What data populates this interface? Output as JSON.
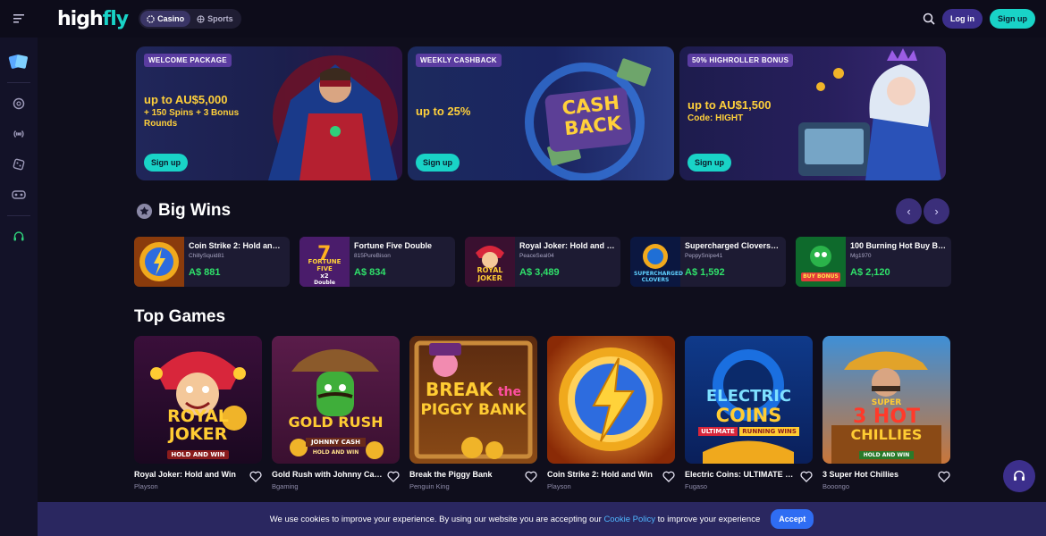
{
  "brand": {
    "logo_high": "high",
    "logo_fly": "fly"
  },
  "header": {
    "tabs": [
      {
        "label": "Casino",
        "icon": "casino-chip-icon",
        "active": true
      },
      {
        "label": "Sports",
        "icon": "sports-icon",
        "active": false
      }
    ],
    "login_label": "Log in",
    "signup_label": "Sign up"
  },
  "sidebar": {
    "items": [
      "promo-cards-icon",
      "chip-icon",
      "live-icon",
      "dice-icon",
      "vr-mask-icon",
      "support-headset-icon"
    ]
  },
  "promos": [
    {
      "tag": "WELCOME PACKAGE",
      "headline": "up to AU$5,000",
      "sub": "+ 150 Spins + 3 Bonus Rounds",
      "button": "Sign up"
    },
    {
      "tag": "WEEKLY CASHBACK",
      "headline": "up to 25%",
      "sub": "",
      "button": "Sign up",
      "art_text_1": "CASH",
      "art_text_2": "BACK"
    },
    {
      "tag": "50% HIGHROLLER BONUS",
      "headline": "up to AU$1,500",
      "sub": "Code: HIGHT",
      "button": "Sign up"
    }
  ],
  "big_wins": {
    "title": "Big Wins",
    "items": [
      {
        "game": "Coin Strike 2: Hold and Win",
        "user": "ChillySquid81",
        "amount": "A$ 881"
      },
      {
        "game": "Fortune Five Double",
        "user": "815PureBison",
        "amount": "A$ 834"
      },
      {
        "game": "Royal Joker: Hold and Win",
        "user": "PeaceSeal04",
        "amount": "A$ 3,489"
      },
      {
        "game": "Supercharged Clovers: Hold and Win",
        "user": "PeppySnipe41",
        "amount": "A$ 1,592"
      },
      {
        "game": "100 Burning Hot Buy Bonus",
        "user": "Mg1970",
        "amount": "A$ 2,120"
      }
    ]
  },
  "top_games": {
    "title": "Top Games",
    "items": [
      {
        "title": "Royal Joker: Hold and Win",
        "provider": "Playson"
      },
      {
        "title": "Gold Rush with Johnny Cash",
        "provider": "Bgaming"
      },
      {
        "title": "Break the Piggy Bank",
        "provider": "Penguin King"
      },
      {
        "title": "Coin Strike 2: Hold and Win",
        "provider": "Playson"
      },
      {
        "title": "Electric Coins: ULTIMATE RUNNING WINS",
        "provider": "Fugaso"
      },
      {
        "title": "3 Super Hot Chillies",
        "provider": "Booongo"
      }
    ]
  },
  "thumb_text": {
    "royal_joker_1": "ROYAL",
    "royal_joker_2": "JOKER",
    "royal_joker_3": "HOLD AND WIN",
    "gold_rush_1": "GOLD RUSH",
    "gold_rush_2": "JOHNNY CASH",
    "gold_rush_3": "HOLD AND WIN",
    "piggy_1": "BREAK",
    "piggy_2": "the",
    "piggy_3": "PIGGY BANK",
    "electric_1": "ELECTRIC",
    "electric_2": "COINS",
    "electric_3": "ULTIMATE",
    "electric_4": "RUNNING WINS",
    "chillies_1": "SUPER",
    "chillies_2": "3 HOT",
    "chillies_3": "CHILLIES",
    "chillies_4": "HOLD AND WIN",
    "fortune_1": "FORTUNE",
    "fortune_2": "FIVE",
    "fortune_3": "x2",
    "fortune_4": "Double",
    "win_joker_1": "ROYAL",
    "win_joker_2": "JOKER",
    "supercharged": "SUPERCHARGED CLOVERS",
    "burning": "BUY BONUS"
  },
  "cookie": {
    "text_before": "We use cookies to improve your experience. By using our website you are accepting our ",
    "link": "Cookie Policy",
    "text_after": " to improve your experience",
    "accept": "Accept"
  },
  "colors": {
    "accent": "#19d3c7",
    "primary": "#3c2f8c",
    "win_green": "#2fe06a",
    "promo_gold": "#ffd03a",
    "link": "#4fb6ff"
  }
}
